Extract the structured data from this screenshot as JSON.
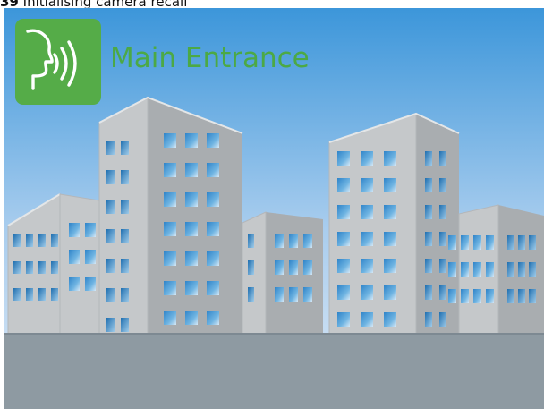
{
  "status": {
    "number": "39",
    "message": "Initialising camera recall"
  },
  "camera": {
    "location_label": "Main Entrance"
  },
  "icons": {
    "badge": "speaking-head-icon"
  },
  "colors": {
    "badge_green": "#55ac48",
    "title_green": "#4ca945",
    "sky_top": "#3c96da",
    "sky_bottom": "#dbe8f5",
    "building_gray": "#c3c6c8",
    "ground_gray": "#8e9aa2",
    "window_blue": "#4fa0d8"
  }
}
